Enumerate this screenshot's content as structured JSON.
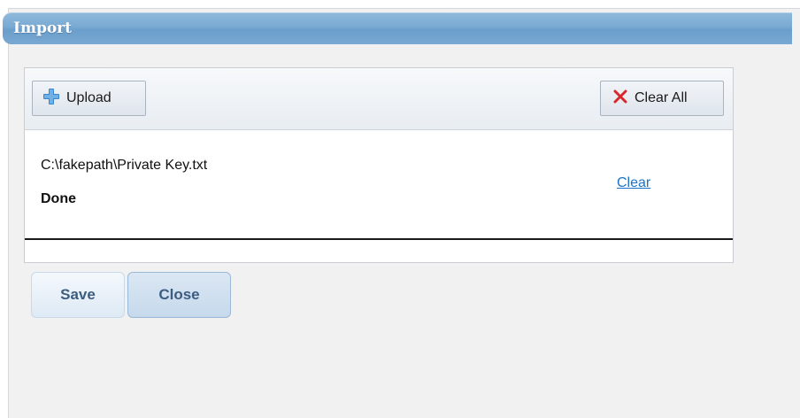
{
  "dialog": {
    "title": "Import"
  },
  "toolbar": {
    "upload_label": "Upload",
    "clear_all_label": "Clear All"
  },
  "files": [
    {
      "path": "C:\\fakepath\\Private Key.txt",
      "status": "Done",
      "clear_label": "Clear"
    }
  ],
  "actions": {
    "save_label": "Save",
    "close_label": "Close"
  },
  "colors": {
    "title_bar": "#7aaad3",
    "link": "#1a73c8",
    "button_text": "#3c5d80",
    "clear_icon": "#d9262b",
    "upload_icon": "#3a86c8"
  },
  "icons": {
    "upload": "plus-icon",
    "clear_all": "x-icon"
  }
}
